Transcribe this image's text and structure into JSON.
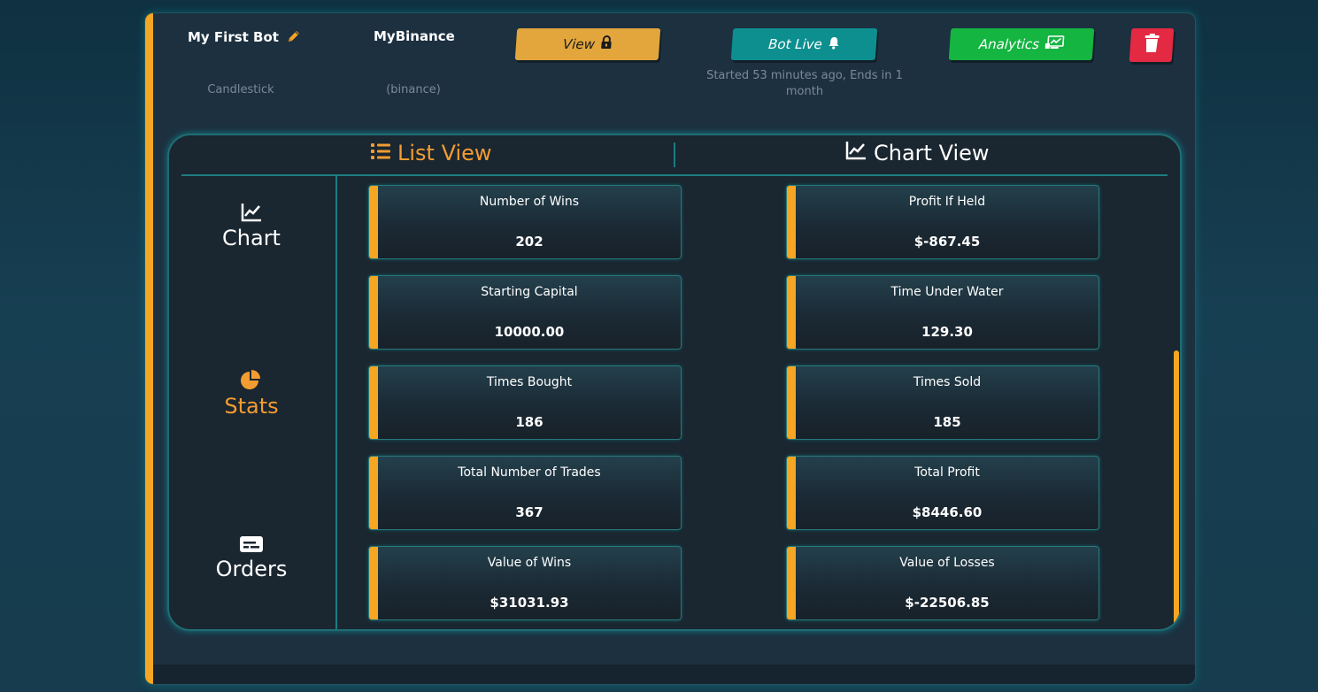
{
  "bot": {
    "name": "My First Bot",
    "strategy": "Candlestick",
    "exchange_name": "MyBinance",
    "exchange_type": "(binance)",
    "status_text": "Started 53 minutes ago, Ends in 1 month"
  },
  "buttons": {
    "view": "View",
    "live": "Bot Live",
    "analytics": "Analytics"
  },
  "tabs": {
    "list": "List View",
    "chart": "Chart View"
  },
  "nav": {
    "chart": "Chart",
    "stats": "Stats",
    "orders": "Orders"
  },
  "stats": {
    "left": [
      {
        "label": "Number of Wins",
        "value": "202"
      },
      {
        "label": "Starting Capital",
        "value": "10000.00"
      },
      {
        "label": "Times Bought",
        "value": "186"
      },
      {
        "label": "Total Number of Trades",
        "value": "367"
      },
      {
        "label": "Value of Wins",
        "value": "$31031.93"
      }
    ],
    "right": [
      {
        "label": "Profit If Held",
        "value": "$-867.45"
      },
      {
        "label": "Time Under Water",
        "value": "129.30"
      },
      {
        "label": "Times Sold",
        "value": "185"
      },
      {
        "label": "Total Profit",
        "value": "$8446.60"
      },
      {
        "label": "Value of Losses",
        "value": "$-22506.85"
      }
    ]
  },
  "colors": {
    "accent": "#f5a623",
    "teal": "#1d7d82",
    "view_button": "#e2a63d",
    "live_button": "#0d8f8f",
    "analytics_button": "#14b541",
    "delete_button": "#e42942"
  },
  "icons": {
    "name_edit": "pencil-icon",
    "view": "lock-icon",
    "live": "bell-icon",
    "analytics": "chart-screen-icon",
    "delete": "trash-icon",
    "list_tab": "list-icon",
    "chart_tab": "line-chart-icon",
    "nav_chart": "line-chart-icon",
    "nav_stats": "pie-chart-icon",
    "nav_orders": "card-icon"
  }
}
